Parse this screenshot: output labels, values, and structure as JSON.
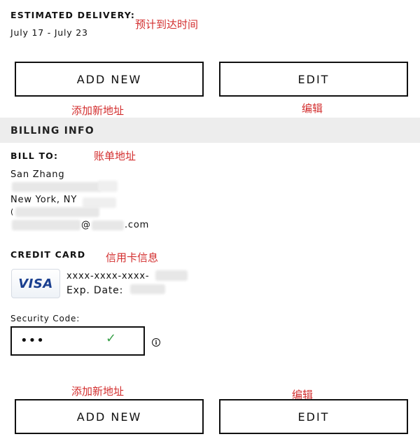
{
  "delivery": {
    "label": "ESTIMATED DELIVERY:",
    "dates": "July 17 - July 23",
    "annotation": "预计到达时间"
  },
  "shipping_buttons": {
    "add_new_label": "ADD NEW",
    "edit_label": "EDIT",
    "add_new_annotation": "添加新地址",
    "edit_annotation": "编辑"
  },
  "billing": {
    "section_title": "BILLING INFO",
    "bill_to_label": "BILL TO:",
    "bill_to_annotation": "账单地址",
    "name": "San Zhang",
    "city_state": "New York, NY",
    "phone_prefix": "(",
    "email_at": "@",
    "email_suffix": ".com"
  },
  "credit_card": {
    "label": "CREDIT CARD",
    "annotation": "信用卡信息",
    "brand": "VISA",
    "number_masked": "xxxx-xxxx-xxxx-",
    "exp_label": "Exp. Date:"
  },
  "security": {
    "label": "Security Code:",
    "value": "•••",
    "check_icon": "checkmark-icon",
    "info_icon": "info-icon"
  },
  "billing_buttons": {
    "add_new_label": "ADD NEW",
    "edit_label": "EDIT",
    "add_new_annotation": "添加新地址",
    "edit_annotation": "编辑"
  },
  "colors": {
    "annotation": "#d32f2f",
    "band": "#ededed",
    "check": "#3aa14a",
    "visa": "#1a3f8f"
  }
}
